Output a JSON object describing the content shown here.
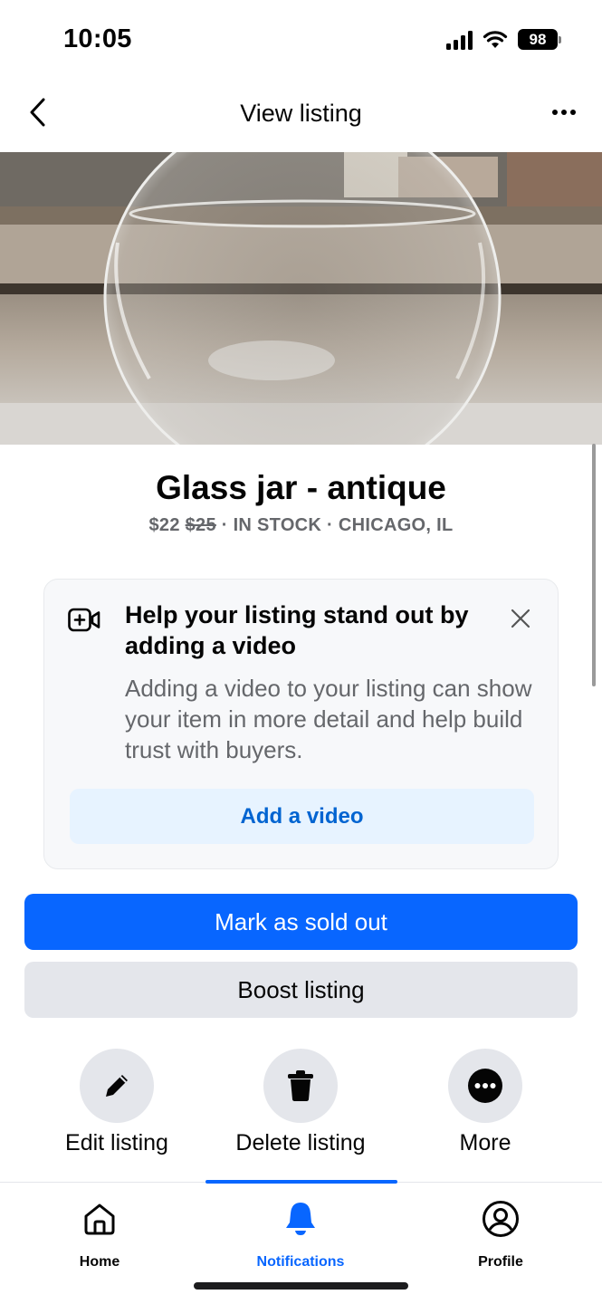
{
  "status_bar": {
    "time": "10:05",
    "battery": "98"
  },
  "header": {
    "title": "View listing",
    "back_icon": "chevron-left-icon",
    "more_icon": "more-horizontal-icon"
  },
  "listing": {
    "title": "Glass jar - antique",
    "price": "$22",
    "original_price": "$25",
    "stock_status": "IN STOCK",
    "location": "CHICAGO, IL",
    "separator": " · "
  },
  "promo": {
    "icon": "video-add-icon",
    "title": "Help your listing stand out by adding a video",
    "body": "Adding a video to your listing can show your item in more detail and help build trust with buyers.",
    "cta_label": "Add a video"
  },
  "actions": {
    "primary_label": "Mark as sold out",
    "secondary_label": "Boost listing"
  },
  "quick_actions": [
    {
      "label": "Edit listing",
      "icon": "pencil-icon"
    },
    {
      "label": "Delete listing",
      "icon": "trash-icon"
    },
    {
      "label": "More",
      "icon": "more-circle-icon"
    }
  ],
  "tabs": [
    {
      "label": "Home",
      "icon": "home-icon",
      "active": false
    },
    {
      "label": "Notifications",
      "icon": "bell-icon",
      "active": true
    },
    {
      "label": "Profile",
      "icon": "profile-icon",
      "active": false
    }
  ],
  "colors": {
    "accent": "#0866ff",
    "link": "#0064d1",
    "secondary_text": "#65676b",
    "button_gray": "#e4e6eb"
  }
}
